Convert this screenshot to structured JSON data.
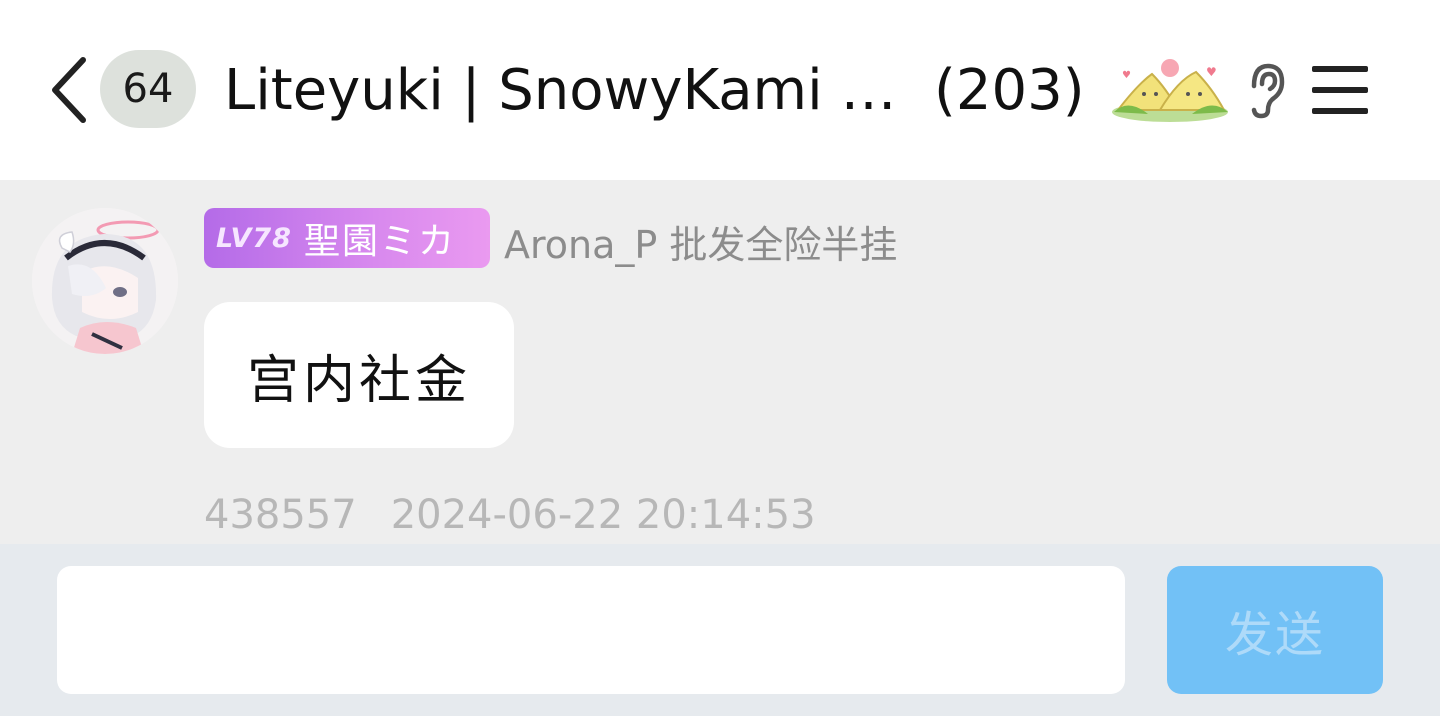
{
  "header": {
    "back_icon": "chevron-left-icon",
    "unread_count": "64",
    "group_name": "Liteyuki | SnowyKami |…",
    "member_count": "(203)",
    "sticker_icon": "zongzi-sticker-icon",
    "ear_icon": "ear-icon",
    "menu_icon": "menu-icon"
  },
  "message": {
    "level": "LV78",
    "member_title": "聖園ミカ",
    "sender": "Arona_P 批发全险半挂",
    "text": "宫内社金",
    "message_id": "438557",
    "timestamp": "2024-06-22 20:14:53"
  },
  "input_bar": {
    "value": "",
    "send_label": "发送"
  },
  "colors": {
    "chat_bg": "#eeeeee",
    "input_bar_bg": "#e6eaee",
    "send_button": "#72c1f6",
    "level_tag_start": "#b46be8",
    "level_tag_end": "#ea9af0"
  }
}
